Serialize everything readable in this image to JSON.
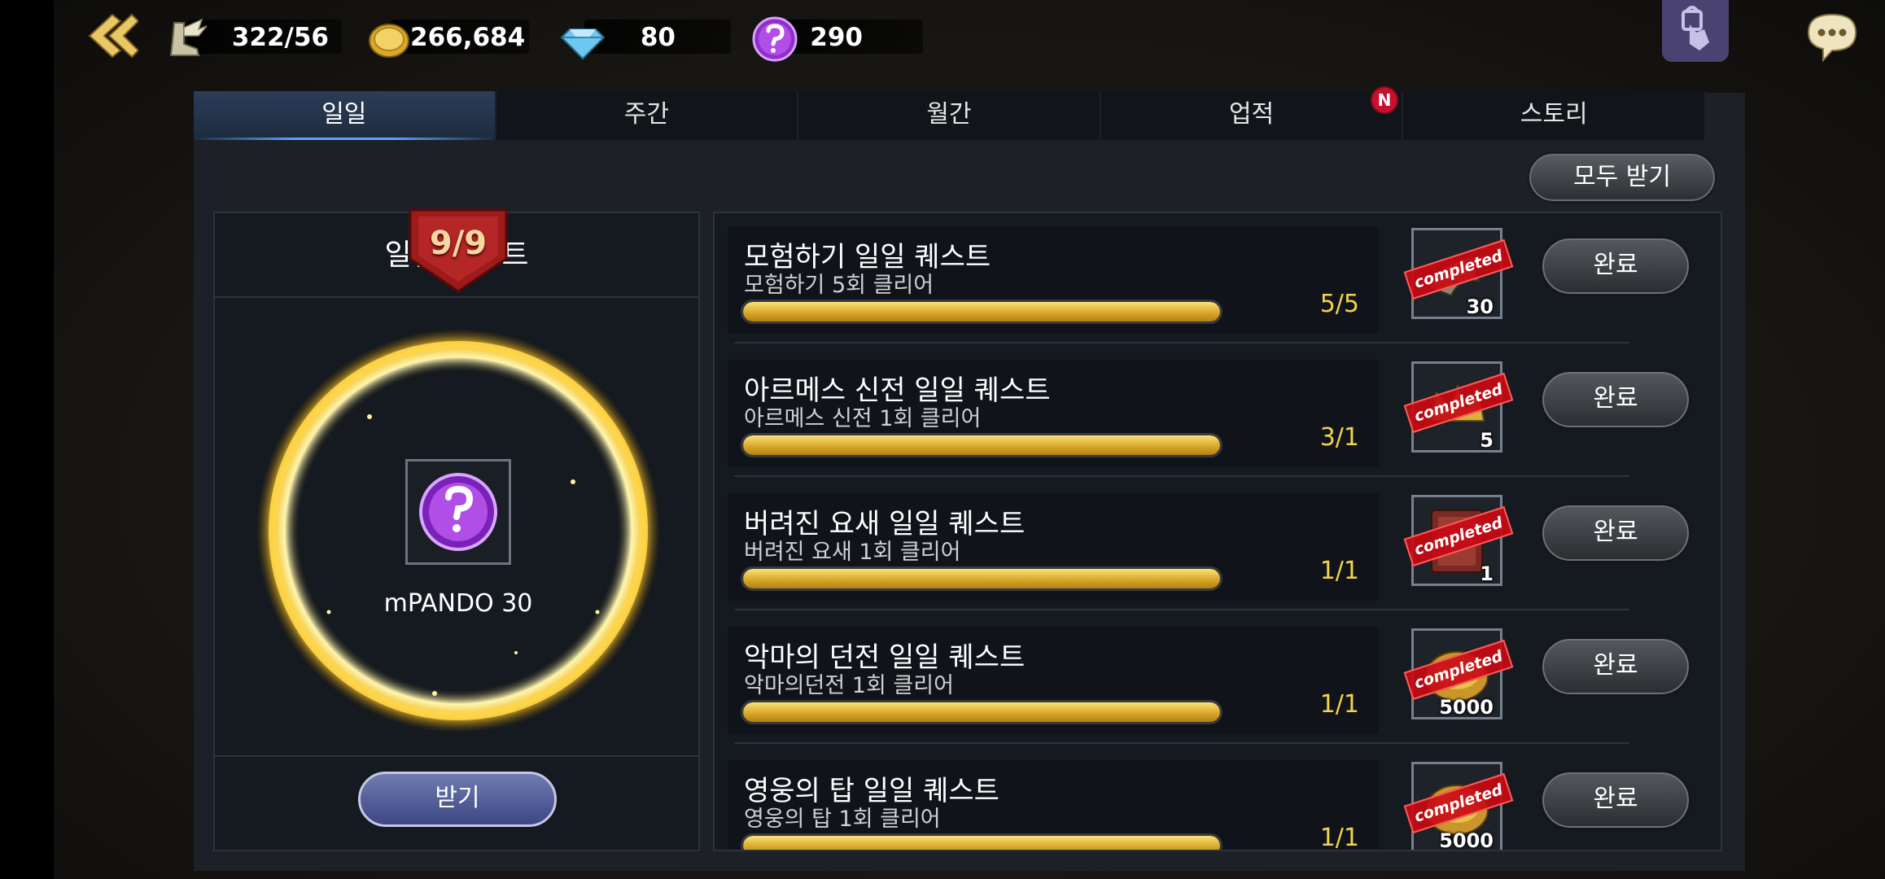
{
  "resources": [
    {
      "name": "stamina",
      "icon": "winged-boot-icon",
      "value": "322/56"
    },
    {
      "name": "gold",
      "icon": "gold-coin-icon",
      "value": "266,684"
    },
    {
      "name": "diamond",
      "icon": "diamond-icon",
      "value": "80"
    },
    {
      "name": "pando",
      "icon": "pando-coin-icon",
      "value": "290"
    }
  ],
  "tabs": [
    {
      "label": "일일",
      "active": true
    },
    {
      "label": "주간",
      "active": false
    },
    {
      "label": "월간",
      "active": false
    },
    {
      "label": "업적",
      "active": false
    },
    {
      "label": "스토리",
      "active": false
    }
  ],
  "badge": "N",
  "claim_all_label": "모두 받기",
  "left_card": {
    "title": "일일 퀘스트",
    "progress": "9/9",
    "reward_label": "mPANDO 30",
    "receive_label": "받기"
  },
  "stamp_text": "completed",
  "quests": [
    {
      "title": "모험하기 일일 퀘스트",
      "sub": "모험하기 5회 클리어",
      "count": "5/5",
      "progress": 1.0,
      "reward_icon": "silver-wing-icon",
      "qty": "30",
      "button": "완료"
    },
    {
      "title": "아르메스 신전 일일 퀘스트",
      "sub": "아르메스 신전 1회 클리어",
      "count": "3/1",
      "progress": 1.0,
      "reward_icon": "gold-crown-icon",
      "qty": "5",
      "button": "완료"
    },
    {
      "title": "버려진 요새 일일 퀘스트",
      "sub": "버려진 요새 1회 클리어",
      "count": "1/1",
      "progress": 1.0,
      "reward_icon": "red-box-icon",
      "qty": "1",
      "button": "완료"
    },
    {
      "title": "악마의 던전 일일 퀘스트",
      "sub": "악마의던전 1회 클리어",
      "count": "1/1",
      "progress": 1.0,
      "reward_icon": "gold-coin-icon",
      "qty": "5000",
      "button": "완료"
    },
    {
      "title": "영웅의 탑 일일 퀘스트",
      "sub": "영웅의 탑 1회 클리어",
      "count": "1/1",
      "progress": 1.0,
      "reward_icon": "gold-coin-icon",
      "qty": "5000",
      "button": "완료"
    }
  ]
}
